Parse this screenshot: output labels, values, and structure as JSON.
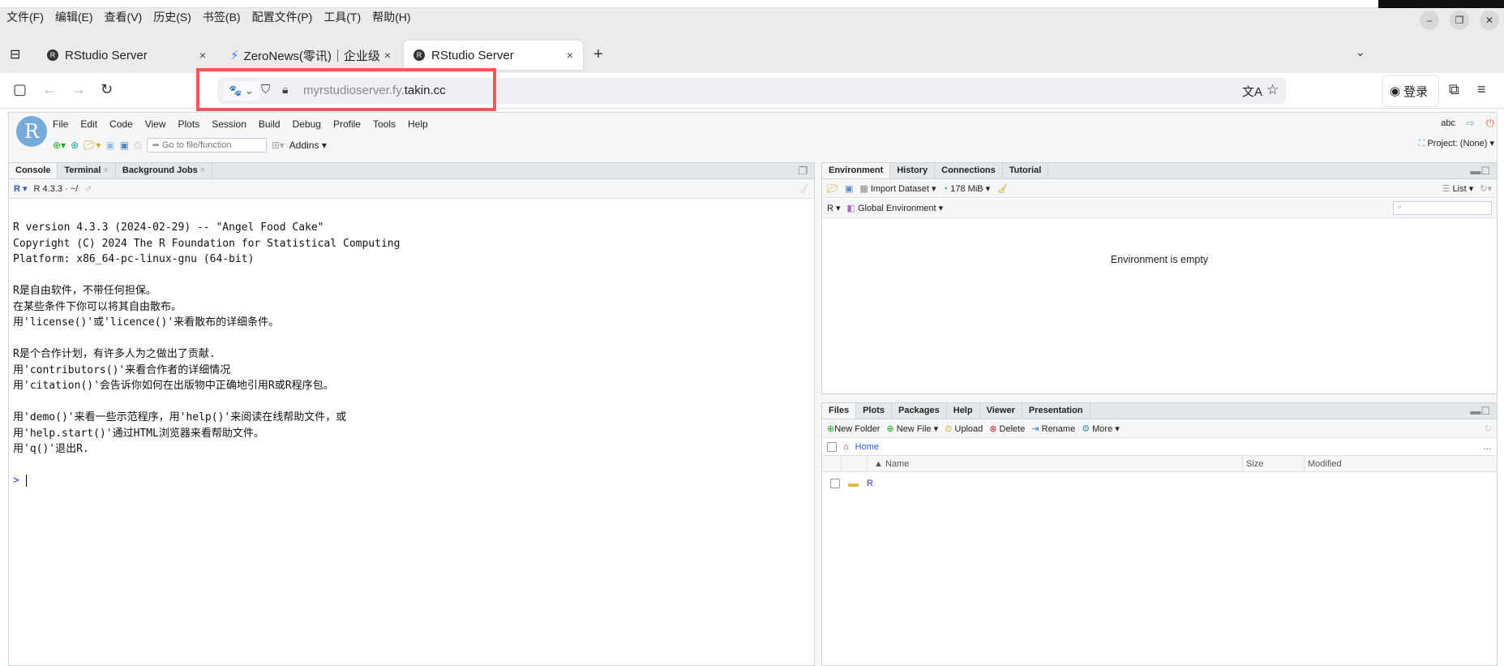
{
  "browser": {
    "menu": [
      "文件(F)",
      "编辑(E)",
      "查看(V)",
      "历史(S)",
      "书签(B)",
      "配置文件(P)",
      "工具(T)",
      "帮助(H)"
    ],
    "tabs": [
      {
        "label": "RStudio Server",
        "active": false
      },
      {
        "label": "ZeroNews(零讯)｜企业级",
        "active": false
      },
      {
        "label": "RStudio Server",
        "active": true
      }
    ],
    "url_host_prefix": "myrstudioserver.fy.",
    "url_host_domain": "takin.cc",
    "login_label": "登录",
    "highlight_color": "#f4545a"
  },
  "rstudio": {
    "menu": [
      "File",
      "Edit",
      "Code",
      "View",
      "Plots",
      "Session",
      "Build",
      "Debug",
      "Profile",
      "Tools",
      "Help"
    ],
    "goto_placeholder": "Go to file/function",
    "addins": "Addins",
    "user": "abc",
    "project": "Project: (None)",
    "console": {
      "tabs": [
        "Console",
        "Terminal",
        "Background Jobs"
      ],
      "version_path": "R 4.3.3 · ~/",
      "lines": [
        "R version 4.3.3 (2024-02-29) -- \"Angel Food Cake\"",
        "Copyright (C) 2024 The R Foundation for Statistical Computing",
        "Platform: x86_64-pc-linux-gnu (64-bit)",
        "",
        "R是自由软件，不带任何担保。",
        "在某些条件下你可以将其自由散布。",
        "用'license()'或'licence()'来看散布的详细条件。",
        "",
        "R是个合作计划，有许多人为之做出了贡献.",
        "用'contributors()'来看合作者的详细情况",
        "用'citation()'会告诉你如何在出版物中正确地引用R或R程序包。",
        "",
        "用'demo()'来看一些示范程序，用'help()'来阅读在线帮助文件，或",
        "用'help.start()'通过HTML浏览器来看帮助文件。",
        "用'q()'退出R."
      ],
      "prompt": ">"
    },
    "env": {
      "tabs": [
        "Environment",
        "History",
        "Connections",
        "Tutorial"
      ],
      "import": "Import Dataset",
      "memory": "178 MiB",
      "view": "List",
      "lang": "R",
      "scope": "Global Environment",
      "empty": "Environment is empty"
    },
    "files": {
      "tabs": [
        "Files",
        "Plots",
        "Packages",
        "Help",
        "Viewer",
        "Presentation"
      ],
      "actions": [
        "New Folder",
        "New File",
        "Upload",
        "Delete",
        "Rename",
        "More"
      ],
      "path": "Home",
      "columns": [
        "Name",
        "Size",
        "Modified"
      ],
      "rows": [
        {
          "name": "R",
          "size": "",
          "modified": ""
        }
      ]
    }
  }
}
